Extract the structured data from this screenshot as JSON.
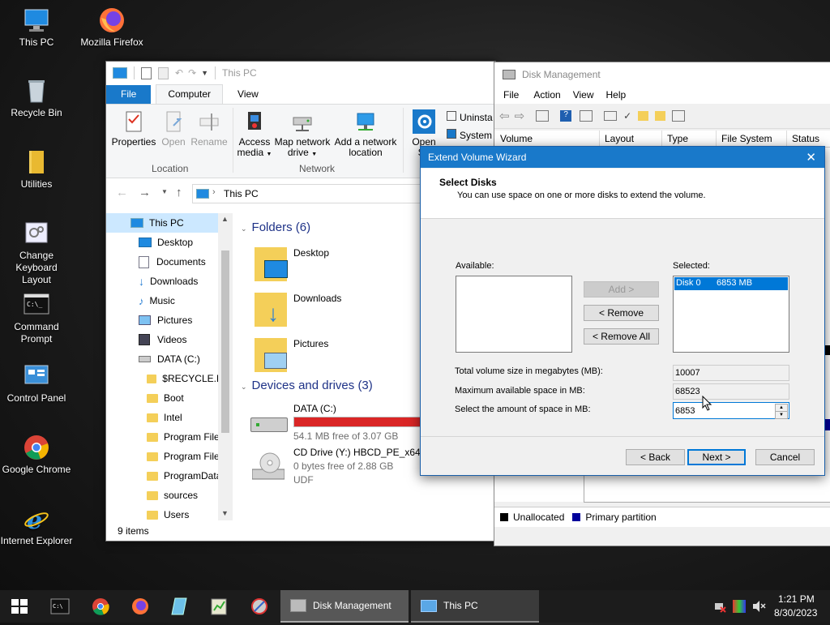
{
  "desktop": {
    "icons": [
      {
        "label": "This PC"
      },
      {
        "label": "Mozilla Firefox"
      },
      {
        "label": "Recycle Bin"
      },
      {
        "label": "Utilities"
      },
      {
        "label": "Change Keyboard Layout"
      },
      {
        "label": "Command Prompt"
      },
      {
        "label": "Control Panel"
      },
      {
        "label": "Google Chrome"
      },
      {
        "label": "Internet Explorer"
      }
    ]
  },
  "explorer": {
    "title": "This PC",
    "tabs": {
      "file": "File",
      "computer": "Computer",
      "view": "View"
    },
    "ribbon": {
      "properties": "Properties",
      "open": "Open",
      "rename": "Rename",
      "access_media": "Access media",
      "map_network_drive": "Map network drive",
      "add_network_location": "Add a network location",
      "open_settings": "Open Se",
      "uninstall": "Uninsta",
      "system": "System",
      "group_location": "Location",
      "group_network": "Network"
    },
    "address": "This PC",
    "nav": [
      {
        "label": "This PC"
      },
      {
        "label": "Desktop"
      },
      {
        "label": "Documents"
      },
      {
        "label": "Downloads"
      },
      {
        "label": "Music"
      },
      {
        "label": "Pictures"
      },
      {
        "label": "Videos"
      },
      {
        "label": "DATA (C:)"
      },
      {
        "label": "$RECYCLE.BIN"
      },
      {
        "label": "Boot"
      },
      {
        "label": "Intel"
      },
      {
        "label": "Program Files"
      },
      {
        "label": "Program Files"
      },
      {
        "label": "ProgramData"
      },
      {
        "label": "sources"
      },
      {
        "label": "Users"
      }
    ],
    "folders_header": "Folders (6)",
    "folders": [
      {
        "name": "Desktop"
      },
      {
        "name": "Downloads"
      },
      {
        "name": "Pictures"
      }
    ],
    "devices_header": "Devices and drives (3)",
    "drives": [
      {
        "name": "DATA (C:)",
        "free": "54.1 MB free of 3.07 GB",
        "used_fraction": 0.98
      },
      {
        "name": "CD Drive (Y:) HBCD_PE_x64",
        "free": "0 bytes free of 2.88 GB",
        "fs": "UDF"
      }
    ],
    "status": "9 items"
  },
  "disk_management": {
    "title": "Disk Management",
    "menu": {
      "file": "File",
      "action": "Action",
      "view": "View",
      "help": "Help"
    },
    "columns": {
      "volume": "Volume",
      "layout": "Layout",
      "type": "Type",
      "file_system": "File System",
      "status": "Status"
    },
    "legend": {
      "unallocated": "Unallocated",
      "primary": "Primary partition"
    }
  },
  "wizard": {
    "title": "Extend Volume Wizard",
    "heading": "Select Disks",
    "subheading": "You can use space on one or more disks to extend the volume.",
    "available_label": "Available:",
    "selected_label": "Selected:",
    "selected_item": {
      "disk": "Disk 0",
      "size": "6853 MB"
    },
    "add_button": "Add >",
    "remove_button": "< Remove",
    "remove_all_button": "< Remove All",
    "total_label": "Total volume size in megabytes (MB):",
    "total_value": "10007",
    "max_label": "Maximum available space in MB:",
    "max_value": "68523",
    "amount_label": "Select the amount of space in MB:",
    "amount_value": "6853",
    "back_button": "< Back",
    "next_button": "Next >",
    "cancel_button": "Cancel"
  },
  "taskbar": {
    "disk_management": "Disk Management",
    "this_pc": "This PC",
    "time": "1:21 PM",
    "date": "8/30/2023"
  },
  "colors": {
    "accent": "#1979ca",
    "drive_bar_full": "#da2626",
    "primary_partition": "#00009c",
    "unallocated": "#000000"
  }
}
